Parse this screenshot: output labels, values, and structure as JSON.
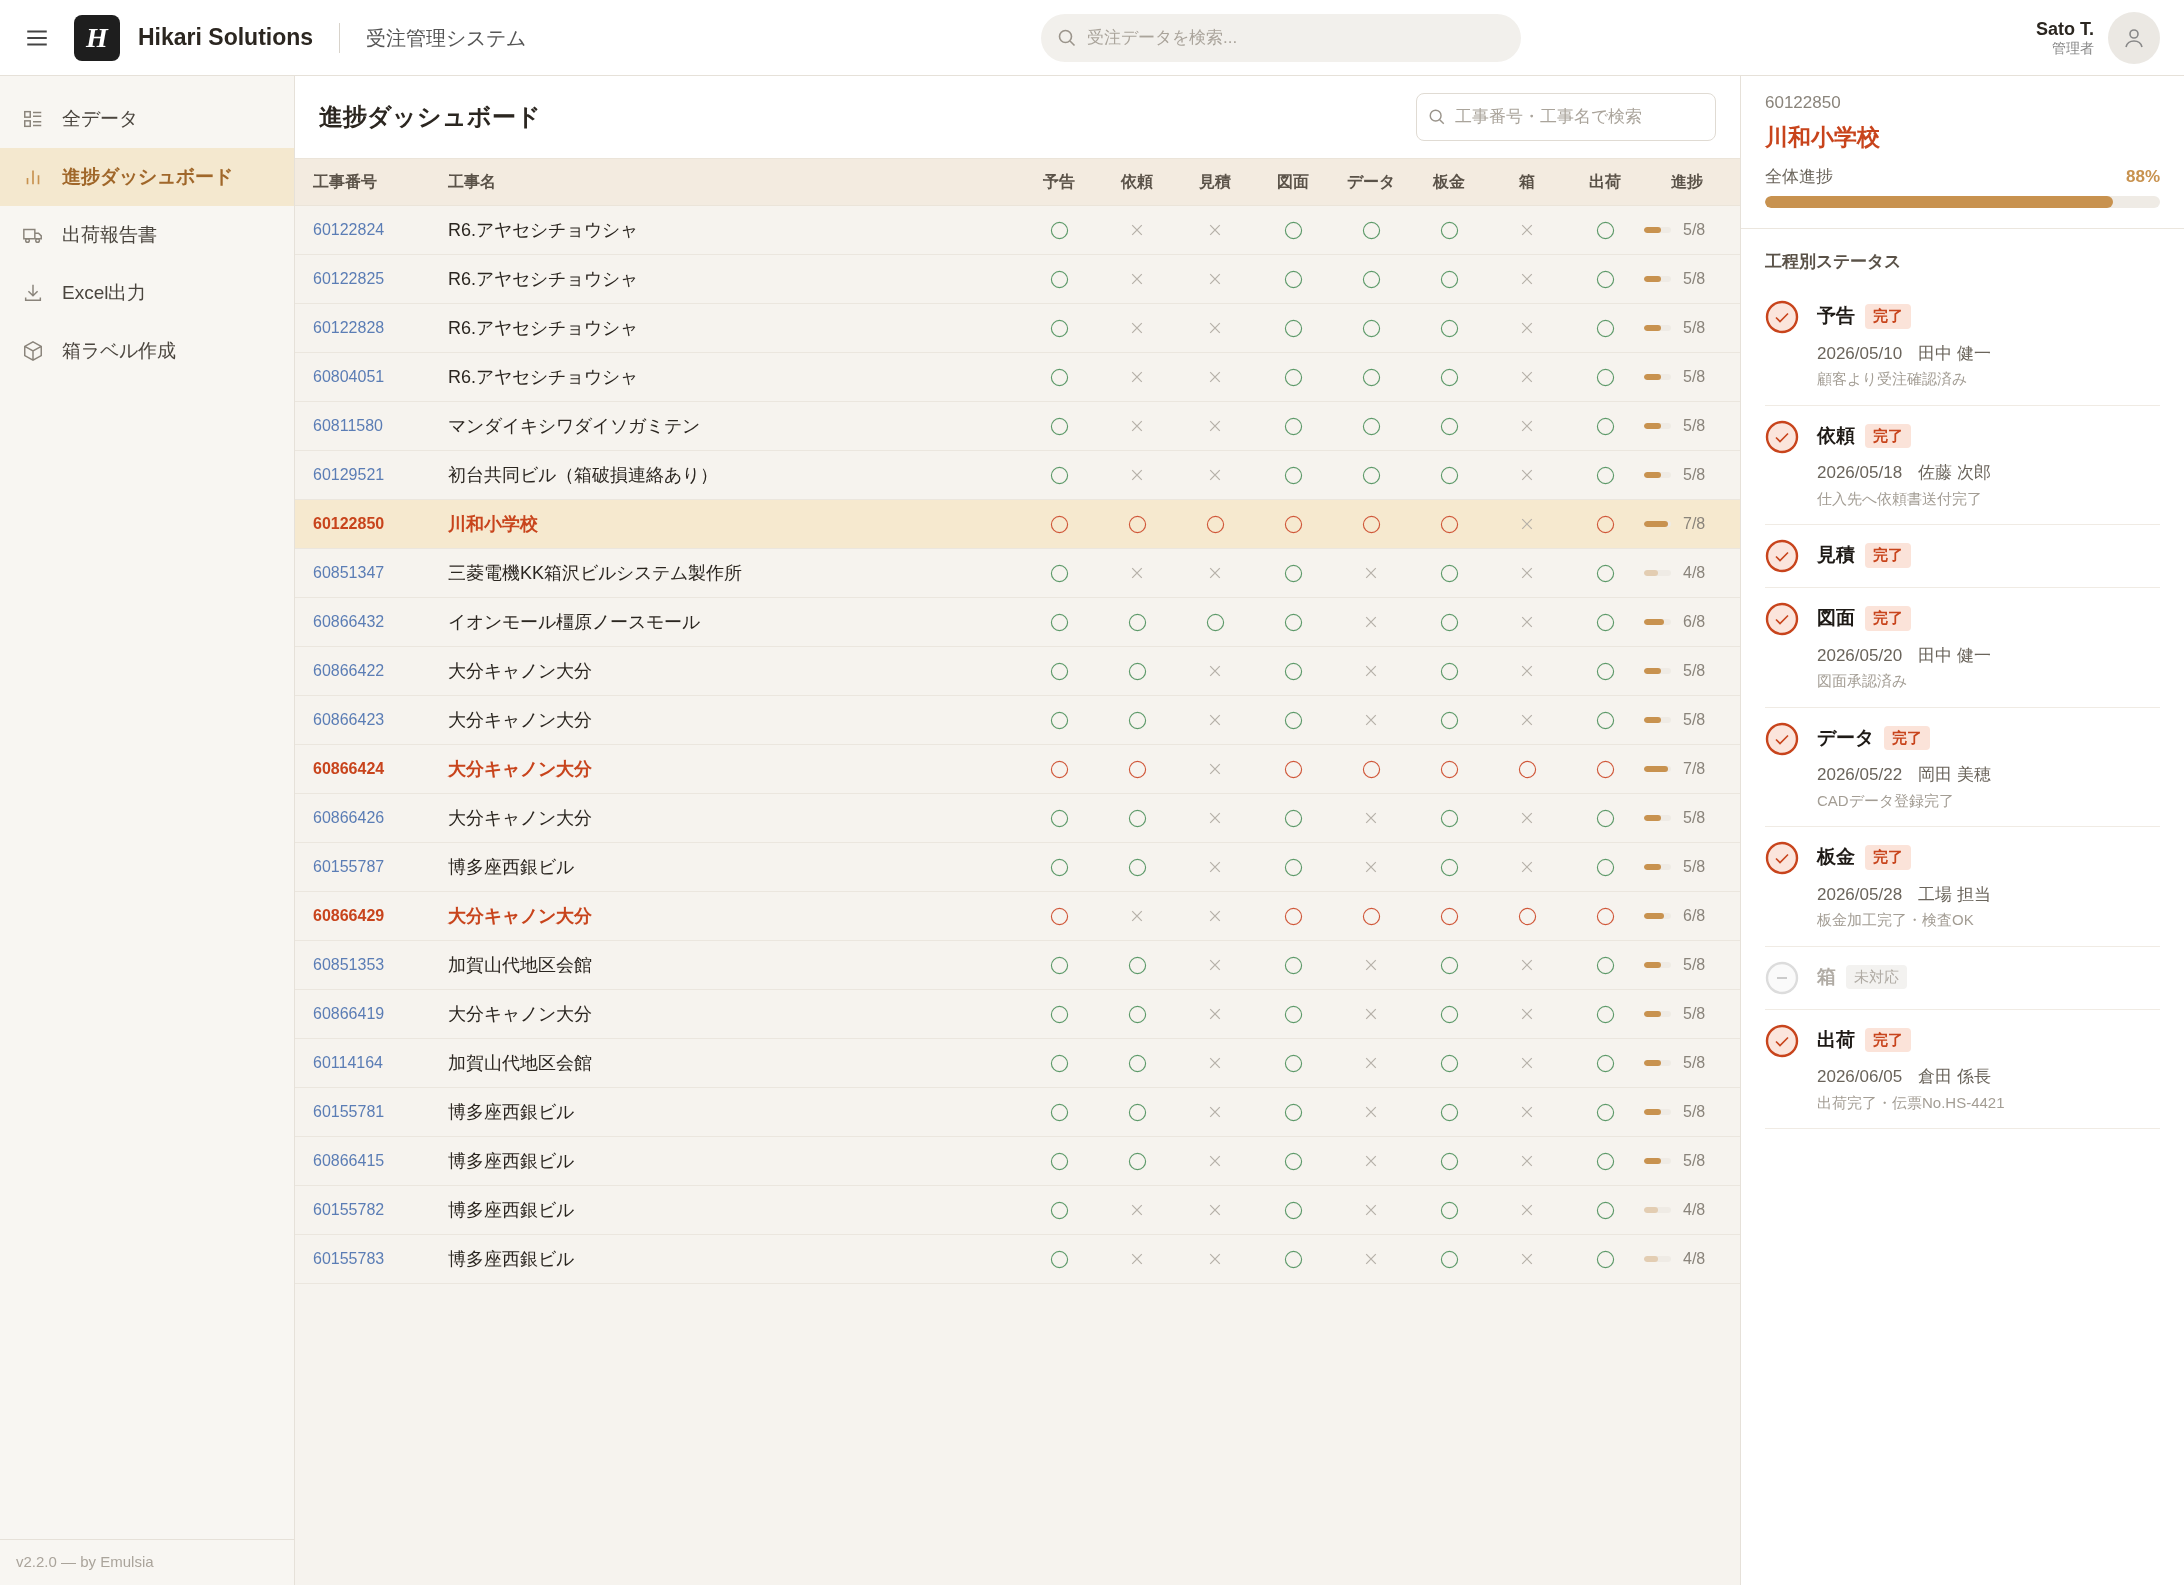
{
  "header": {
    "brand_mark": "H",
    "brand": "Hikari Solutions",
    "app_name": "受注管理システム",
    "search": {
      "placeholder": "受注データを検索..."
    },
    "user": {
      "name": "Sato T.",
      "role": "管理者"
    }
  },
  "sidebar": {
    "items": [
      {
        "label": "全データ",
        "kind": "grid",
        "selected": false
      },
      {
        "label": "進捗ダッシュボード",
        "kind": "chart",
        "selected": true
      },
      {
        "label": "出荷報告書",
        "kind": "truck",
        "selected": false
      },
      {
        "label": "Excel出力",
        "kind": "download",
        "selected": false
      },
      {
        "label": "箱ラベル作成",
        "kind": "box",
        "selected": false
      }
    ],
    "footer": "v2.2.0 — by Emulsia"
  },
  "main": {
    "title": "進捗ダッシュボード",
    "search": {
      "placeholder": "工事番号・工事名で検索"
    },
    "columns": [
      "工事番号",
      "工事名",
      "予告",
      "依頼",
      "見積",
      "図面",
      "データ",
      "板金",
      "箱",
      "出荷",
      "進捗"
    ],
    "rows": [
      {
        "number": "60122824",
        "name": "R6.アヤセシチョウシャ",
        "steps": [
          true,
          false,
          false,
          true,
          true,
          true,
          false,
          true
        ],
        "progress": "5/8",
        "level": 0.625,
        "selected": false,
        "flagged": false
      },
      {
        "number": "60122825",
        "name": "R6.アヤセシチョウシャ",
        "steps": [
          true,
          false,
          false,
          true,
          true,
          true,
          false,
          true
        ],
        "progress": "5/8",
        "level": 0.625,
        "selected": false,
        "flagged": false
      },
      {
        "number": "60122828",
        "name": "R6.アヤセシチョウシャ",
        "steps": [
          true,
          false,
          false,
          true,
          true,
          true,
          false,
          true
        ],
        "progress": "5/8",
        "level": 0.625,
        "selected": false,
        "flagged": false
      },
      {
        "number": "60804051",
        "name": "R6.アヤセシチョウシャ",
        "steps": [
          true,
          false,
          false,
          true,
          true,
          true,
          false,
          true
        ],
        "progress": "5/8",
        "level": 0.625,
        "selected": false,
        "flagged": false
      },
      {
        "number": "60811580",
        "name": "マンダイキシワダイソガミテン",
        "steps": [
          true,
          false,
          false,
          true,
          true,
          true,
          false,
          true
        ],
        "progress": "5/8",
        "level": 0.625,
        "selected": false,
        "flagged": false
      },
      {
        "number": "60129521",
        "name": "初台共同ビル（箱破損連絡あり）",
        "steps": [
          true,
          false,
          false,
          true,
          true,
          true,
          false,
          true
        ],
        "progress": "5/8",
        "level": 0.625,
        "selected": false,
        "flagged": false
      },
      {
        "number": "60122850",
        "name": "川和小学校",
        "steps": [
          true,
          true,
          true,
          true,
          true,
          true,
          false,
          true
        ],
        "progress": "7/8",
        "level": 0.875,
        "selected": true,
        "flagged": true
      },
      {
        "number": "60851347",
        "name": "三菱電機KK箱沢ビルシステム製作所",
        "steps": [
          true,
          false,
          false,
          true,
          false,
          true,
          false,
          true
        ],
        "progress": "4/8",
        "level": 0.5,
        "selected": false,
        "flagged": false
      },
      {
        "number": "60866432",
        "name": "イオンモール橿原ノースモール",
        "steps": [
          true,
          true,
          true,
          true,
          false,
          true,
          false,
          true
        ],
        "progress": "6/8",
        "level": 0.75,
        "selected": false,
        "flagged": false
      },
      {
        "number": "60866422",
        "name": "大分キャノン大分",
        "steps": [
          true,
          true,
          false,
          true,
          false,
          true,
          false,
          true
        ],
        "progress": "5/8",
        "level": 0.625,
        "selected": false,
        "flagged": false
      },
      {
        "number": "60866423",
        "name": "大分キャノン大分",
        "steps": [
          true,
          true,
          false,
          true,
          false,
          true,
          false,
          true
        ],
        "progress": "5/8",
        "level": 0.625,
        "selected": false,
        "flagged": false
      },
      {
        "number": "60866424",
        "name": "大分キャノン大分",
        "steps": [
          true,
          true,
          false,
          true,
          true,
          true,
          true,
          true
        ],
        "progress": "7/8",
        "level": 0.875,
        "selected": false,
        "flagged": true
      },
      {
        "number": "60866426",
        "name": "大分キャノン大分",
        "steps": [
          true,
          true,
          false,
          true,
          false,
          true,
          false,
          true
        ],
        "progress": "5/8",
        "level": 0.625,
        "selected": false,
        "flagged": false
      },
      {
        "number": "60155787",
        "name": "博多座西銀ビル",
        "steps": [
          true,
          true,
          false,
          true,
          false,
          true,
          false,
          true
        ],
        "progress": "5/8",
        "level": 0.625,
        "selected": false,
        "flagged": false
      },
      {
        "number": "60866429",
        "name": "大分キャノン大分",
        "steps": [
          true,
          false,
          false,
          true,
          true,
          true,
          true,
          true
        ],
        "progress": "6/8",
        "level": 0.75,
        "selected": false,
        "flagged": true
      },
      {
        "number": "60851353",
        "name": "加賀山代地区会館",
        "steps": [
          true,
          true,
          false,
          true,
          false,
          true,
          false,
          true
        ],
        "progress": "5/8",
        "level": 0.625,
        "selected": false,
        "flagged": false
      },
      {
        "number": "60866419",
        "name": "大分キャノン大分",
        "steps": [
          true,
          true,
          false,
          true,
          false,
          true,
          false,
          true
        ],
        "progress": "5/8",
        "level": 0.625,
        "selected": false,
        "flagged": false
      },
      {
        "number": "60114164",
        "name": "加賀山代地区会館",
        "steps": [
          true,
          true,
          false,
          true,
          false,
          true,
          false,
          true
        ],
        "progress": "5/8",
        "level": 0.625,
        "selected": false,
        "flagged": false
      },
      {
        "number": "60155781",
        "name": "博多座西銀ビル",
        "steps": [
          true,
          true,
          false,
          true,
          false,
          true,
          false,
          true
        ],
        "progress": "5/8",
        "level": 0.625,
        "selected": false,
        "flagged": false
      },
      {
        "number": "60866415",
        "name": "博多座西銀ビル",
        "steps": [
          true,
          true,
          false,
          true,
          false,
          true,
          false,
          true
        ],
        "progress": "5/8",
        "level": 0.625,
        "selected": false,
        "flagged": false
      },
      {
        "number": "60155782",
        "name": "博多座西銀ビル",
        "steps": [
          true,
          false,
          false,
          true,
          false,
          true,
          false,
          true
        ],
        "progress": "4/8",
        "level": 0.5,
        "selected": false,
        "flagged": false
      },
      {
        "number": "60155783",
        "name": "博多座西銀ビル",
        "steps": [
          true,
          false,
          false,
          true,
          false,
          true,
          false,
          true
        ],
        "progress": "4/8",
        "level": 0.5,
        "selected": false,
        "flagged": false
      }
    ]
  },
  "detail": {
    "number": "60122850",
    "name": "川和小学校",
    "progress_label": "全体進捗",
    "progress_value": "88%",
    "level": 0.88,
    "section_title": "工程別ステータス",
    "steps": [
      {
        "label": "予告",
        "status": "完了",
        "done": true,
        "date": "2026/05/10",
        "person": "田中 健一",
        "note": "顧客より受注確認済み"
      },
      {
        "label": "依頼",
        "status": "完了",
        "done": true,
        "date": "2026/05/18",
        "person": "佐藤 次郎",
        "note": "仕入先へ依頼書送付完了"
      },
      {
        "label": "見積",
        "status": "完了",
        "done": true
      },
      {
        "label": "図面",
        "status": "完了",
        "done": true,
        "date": "2026/05/20",
        "person": "田中 健一",
        "note": "図面承認済み"
      },
      {
        "label": "データ",
        "status": "完了",
        "done": true,
        "date": "2026/05/22",
        "person": "岡田 美穂",
        "note": "CADデータ登録完了"
      },
      {
        "label": "板金",
        "status": "完了",
        "done": true,
        "date": "2026/05/28",
        "person": "工場 担当",
        "note": "板金加工完了・検査OK"
      },
      {
        "label": "箱",
        "status": "未対応",
        "done": false
      },
      {
        "label": "出荷",
        "status": "完了",
        "done": true,
        "date": "2026/06/05",
        "person": "倉田 係長",
        "note": "出荷完了・伝票No.HS-4421"
      }
    ]
  }
}
